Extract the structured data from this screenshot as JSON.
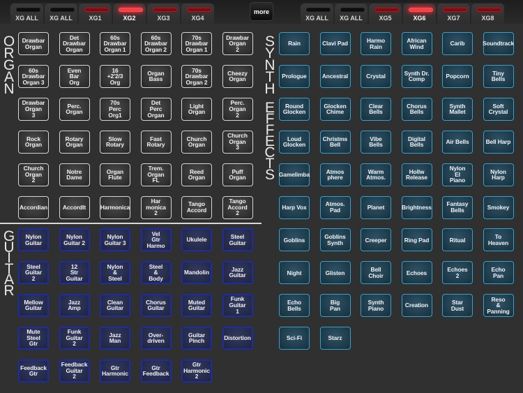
{
  "tabs_left": [
    {
      "label": "XG ALL",
      "led": "off",
      "active": false
    },
    {
      "label": "XG ALL",
      "led": "off",
      "active": false
    },
    {
      "label": "XG1",
      "led": "red",
      "active": false
    },
    {
      "label": "XG2",
      "led": "on",
      "active": true
    },
    {
      "label": "XG3",
      "led": "red",
      "active": false
    },
    {
      "label": "XG4",
      "led": "red",
      "active": false
    }
  ],
  "more_label": "more",
  "tabs_right": [
    {
      "label": "XG ALL",
      "led": "off",
      "active": false
    },
    {
      "label": "XG ALL",
      "led": "off",
      "active": false
    },
    {
      "label": "XG5",
      "led": "red",
      "active": false
    },
    {
      "label": "XG6",
      "led": "on",
      "active": true
    },
    {
      "label": "XG7",
      "led": "red",
      "active": false
    },
    {
      "label": "XG8",
      "led": "red",
      "active": false
    }
  ],
  "sections": {
    "organ": {
      "title": "ORGAN",
      "color": "#d6d6d6",
      "items": [
        "Drawbar\nOrgan",
        "Det\nDrawbar\nOrgan",
        "60s\nDrawbar\nOrgan 1",
        "60s\nDrawbar\nOrgan 2",
        "70s\nDrawbar\nOrgan 1",
        "Drawbar\nOrgan\n2",
        "60s\nDrawbar\nOrgan 3",
        "Even\nBar\nOrg",
        "16\n+2'2/3\nOrg",
        "Organ\nBass",
        "70s\nDrawbar\nOrgan 2",
        "Cheezy\nOrgan",
        "Drawbar\nOrgan\n3",
        "Perc.\nOrgan",
        "70s\nPerc\nOrg1",
        "Det\nPerc\nOrgan",
        "Light\nOrgan",
        "Perc.\nOrgan\n2",
        "Rock\nOrgan",
        "Rotary\nOrgan",
        "Slow\nRotary",
        "Fast\nRotary",
        "Church\nOrgan",
        "Church\nOrgan\n3",
        "Church\nOrgan\n2",
        "Notre\nDame",
        "Organ\nFlute",
        "Trem.\nOrgan\nFL",
        "Reed\nOrgan",
        "Puff\nOrgan",
        "Accordian",
        "AccordIt",
        "Harmonica",
        "Har\nmonica\n2",
        "Tango\nAccord",
        "Tango\nAccord\n2"
      ]
    },
    "guitar": {
      "title": "GUITAR",
      "color": "#1c2ca8",
      "items": [
        "Nylon\nGuitar",
        "Nylon\nGuitar 2",
        "Nylon\nGuitar 3",
        "Vel\nGtr\nHarmo",
        "Ukulele",
        "Steel\nGuitar",
        "Steel\nGuitar\n2",
        "12\nStr\nGuitar",
        "Nylon\n&\nSteel",
        "Steel\n&\nBody",
        "Mandolin",
        "Jazz\nGuitar",
        "Mellow\nGuitar",
        "Jazz\nAmp",
        "Clean\nGuitar",
        "Chorus\nGuitar",
        "Muted\nGuitar",
        "Funk\nGuitar\n1",
        "Mute\nSteel\nGtr",
        "Funk\nGuitar\n2",
        "Jazz\nMan",
        "Over-\ndriven",
        "Guitar\nPinch",
        "Distortion",
        "Feedback\nGtr",
        "Feedback\nGuitar\n2",
        "Gtr\nHarmonic",
        "Gtr\nFeedback",
        "Gtr\nHarmonic\n2"
      ]
    },
    "synth_effects": {
      "title_top": "SYNTH",
      "title_bottom": "EFFECTS",
      "color": "#2fa3d4",
      "items": [
        "Rain",
        "Clavi Pad",
        "Harmo\nRain",
        "African\nWind",
        "Carib",
        "Soundtrack",
        "Prologue",
        "Ancestral",
        "Crystal",
        "Synth Dr.\nComp",
        "Popcorn",
        "Tiny\nBells",
        "Round\nGlocken",
        "Glocken\nChime",
        "Clear\nBells",
        "Chorus\nBells",
        "Synth\nMallet",
        "Soft\nCrystal",
        "Loud\nGlocken",
        "Christms\nBell",
        "Vibe\nBells",
        "Digital\nBells",
        "Air Bells",
        "Bell Harp",
        "Gamelimba",
        "Atmos\nphere",
        "Warm\nAtmos.",
        "Hollw\nRelease",
        "Nylon\nEl\nPiano",
        "Nylon\nHarp",
        "Harp Vox",
        "Atmos.\nPad",
        "Planet",
        "Brightness",
        "Fantasy\nBells",
        "Smokey",
        "Goblins",
        "Goblins\nSynth",
        "Creeper",
        "Ring Pad",
        "Ritual",
        "To\nHeaven",
        "Night",
        "Glisten",
        "Bell\nChoir",
        "Echoes",
        "Echoes\n2",
        "Echo\nPan",
        "Echo\nBells",
        "Big\nPan",
        "Synth\nPiano",
        "Creation",
        "Star\nDust",
        "Reso\n&\nPanning",
        "Sci-Fi",
        "Starz"
      ]
    }
  }
}
